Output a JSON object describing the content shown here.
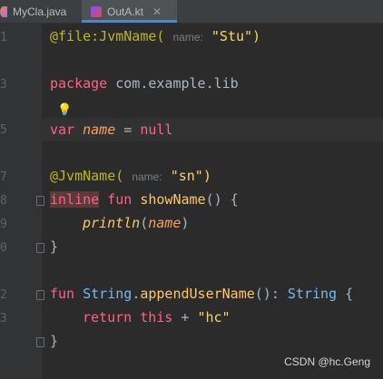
{
  "tabs": [
    {
      "label": "MyCla.java"
    },
    {
      "label": "OutA.kt",
      "close": "✕"
    }
  ],
  "gutter": {
    "lines": [
      "1",
      "",
      "3",
      "",
      "5",
      "",
      "7",
      "8",
      "9",
      "0",
      "",
      "2",
      "3",
      ""
    ]
  },
  "code": {
    "l1_ann": "@file:JvmName(",
    "l1_hint": "name:",
    "l1_str": "\"Stu\")",
    "l3_kw": "package",
    "l3_pkg": " com.example.lib",
    "l5_kw": "var",
    "l5_prop": "name",
    "l5_rest": " = ",
    "l5_null": "null",
    "l7_ann": "@JvmName(",
    "l7_hint": "name:",
    "l7_str": "\"sn\")",
    "l8_inline": "inline",
    "l8_fun": " fun",
    "l8_name": " showName",
    "l8_rest": "() {",
    "l9_fn": "println",
    "l9_paren": "(",
    "l9_arg": "name",
    "l9_close": ")",
    "l10": "}",
    "l12_fun": "fun",
    "l12_type": " String",
    "l12_dot": ".",
    "l12_name": "appendUserName",
    "l12_rest": "(): ",
    "l12_ret": "String",
    "l12_brace": " {",
    "l13_return": "return",
    "l13_this": " this",
    "l13_plus": " + ",
    "l13_str": "\"hc\"",
    "l14": "}"
  },
  "watermark": "CSDN @hc.Geng",
  "colors": {
    "accent": "#4a88c7",
    "background": "#2b2b2b"
  }
}
